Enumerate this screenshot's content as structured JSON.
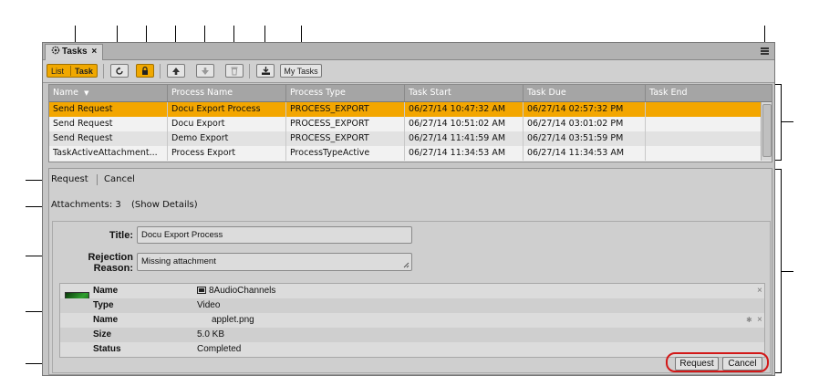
{
  "window": {
    "tab_label": "Tasks",
    "tab_close": "×",
    "tab_icon": "settings-gear-icon",
    "menu_icon": "hamburger-menu-icon"
  },
  "toolbar": {
    "list_label": "List",
    "task_label": "Task",
    "refresh_icon": "refresh-icon",
    "lock_icon": "lock-icon",
    "move_up_icon": "arrow-up-icon",
    "move_down_icon": "arrow-down-icon",
    "delete_icon": "trash-icon",
    "export_icon": "download-tray-icon",
    "my_tasks_label": "My Tasks",
    "accent_color": "#f0a800"
  },
  "table": {
    "columns": [
      "Name",
      "Process Name",
      "Process Type",
      "Task Start",
      "Task Due",
      "Task End"
    ],
    "sort_indicator": "▼",
    "rows": [
      {
        "name": "Send Request",
        "process_name": "Docu Export Process",
        "process_type": "PROCESS_EXPORT",
        "task_start": "06/27/14 10:47:32 AM",
        "task_due": "06/27/14 02:57:32 PM",
        "task_end": "",
        "selected": true
      },
      {
        "name": "Send Request",
        "process_name": "Docu Export",
        "process_type": "PROCESS_EXPORT",
        "task_start": "06/27/14 10:51:02 AM",
        "task_due": "06/27/14 03:01:02 PM",
        "task_end": "",
        "selected": false
      },
      {
        "name": "Send Request",
        "process_name": "Demo Export",
        "process_type": "PROCESS_EXPORT",
        "task_start": "06/27/14 11:41:59 AM",
        "task_due": "06/27/14 03:51:59 PM",
        "task_end": "",
        "selected": false
      },
      {
        "name": "TaskActiveAttachment...",
        "process_name": "Process Export",
        "process_type": "ProcessTypeActive",
        "task_start": "06/27/14 11:34:53 AM",
        "task_due": "06/27/14 11:34:53 AM",
        "task_end": "",
        "selected": false
      }
    ]
  },
  "detail": {
    "action_request": "Request",
    "action_cancel": "Cancel",
    "attachments_text": "Attachments: 3",
    "show_details": "(Show Details)",
    "title_label": "Title:",
    "title_value": "Docu Export Process",
    "rejection_label_1": "Rejection",
    "rejection_label_2": "Reason:",
    "rejection_value": "Missing attachment",
    "attachment": {
      "rows": [
        {
          "key": "Name",
          "value": "8AudioChannels"
        },
        {
          "key": "Type",
          "value": "Video"
        },
        {
          "key": "Name",
          "value": "applet.png"
        },
        {
          "key": "Size",
          "value": "5.0 KB"
        },
        {
          "key": "Status",
          "value": "Completed"
        }
      ],
      "close_glyph": "×",
      "pin_glyph": "✱"
    },
    "bottom_request": "Request",
    "bottom_cancel": "Cancel",
    "highlight_color": "#d21818"
  }
}
